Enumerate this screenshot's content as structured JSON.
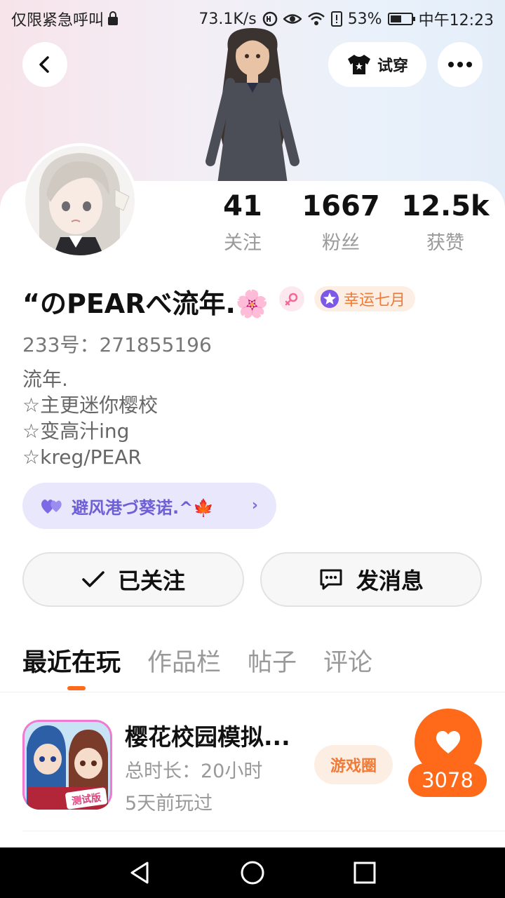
{
  "status_bar": {
    "left_text": "仅限紧急呼叫",
    "network_speed": "73.1K/s",
    "battery_percent": "53%",
    "battery_level": 0.53,
    "time": "中午12:23"
  },
  "header": {
    "back_icon": "chevron-left-icon",
    "try_on_label": "试穿",
    "more_icon": "more-dots-icon"
  },
  "stats": [
    {
      "value": "41",
      "label": "关注"
    },
    {
      "value": "1667",
      "label": "粉丝"
    },
    {
      "value": "12.5k",
      "label": "获赞"
    }
  ],
  "profile": {
    "nickname": "“のPEARべ流年.🌸",
    "gender_icon": "female-icon",
    "badge_label": "幸运七月",
    "uid_label": "233号：",
    "uid_value": "271855196",
    "bio_lines": [
      "流年.",
      "☆主更迷你樱校",
      "☆变高汁ing",
      "☆kreg/PEAR"
    ],
    "guild_name": "避风港づ葵诺.^🍁"
  },
  "actions": {
    "follow_label": "已关注",
    "message_label": "发消息"
  },
  "tabs": [
    "最近在玩",
    "作品栏",
    "帖子",
    "评论"
  ],
  "recent_game": {
    "title": "樱花校园模拟...",
    "total_time": "总时长：20小时",
    "last_played": "5天前玩过",
    "icon_label": "测试版",
    "circle_label": "游戏圈",
    "likes": "3078"
  },
  "colors": {
    "accent_orange": "#ff6a1a",
    "guild_purple": "#6d5fd6",
    "badge_orange": "#f07a36"
  }
}
